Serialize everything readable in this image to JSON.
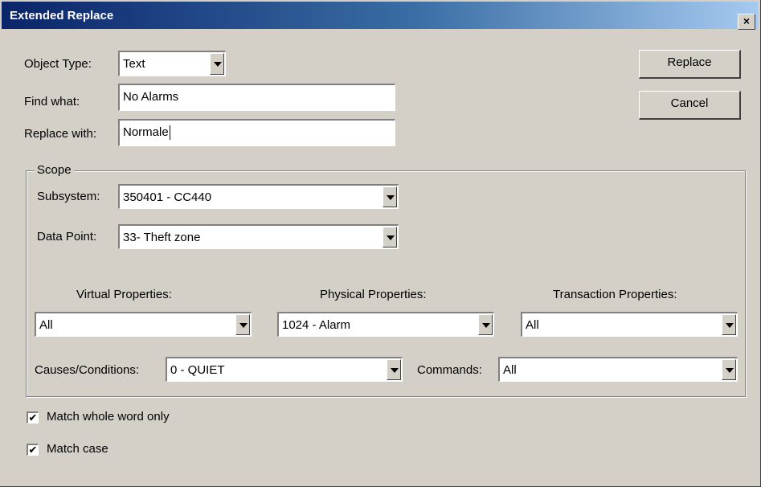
{
  "window": {
    "title": "Extended Replace",
    "close_label": "×"
  },
  "object_type": {
    "label": "Object Type:",
    "value": "Text"
  },
  "find_what": {
    "label": "Find what:",
    "value": "No Alarms"
  },
  "replace_with": {
    "label": "Replace with:",
    "value": "Normale"
  },
  "buttons": {
    "replace": "Replace",
    "cancel": "Cancel"
  },
  "scope": {
    "title": "Scope",
    "subsystem": {
      "label": "Subsystem:",
      "value": "350401 - CC440"
    },
    "data_point": {
      "label": "Data Point:",
      "value": "33- Theft zone"
    },
    "virtual_properties": {
      "label": "Virtual Properties:",
      "value": "All"
    },
    "physical_properties": {
      "label": "Physical Properties:",
      "value": "1024 - Alarm"
    },
    "transaction_properties": {
      "label": "Transaction Properties:",
      "value": "All"
    },
    "causes_conditions": {
      "label": "Causes/Conditions:",
      "value": "0 - QUIET"
    },
    "commands": {
      "label": "Commands:",
      "value": "All"
    }
  },
  "options": {
    "match_whole_word": {
      "label": "Match whole word only",
      "checked": true
    },
    "match_case": {
      "label": "Match case",
      "checked": true
    }
  },
  "check_glyph": "✔"
}
